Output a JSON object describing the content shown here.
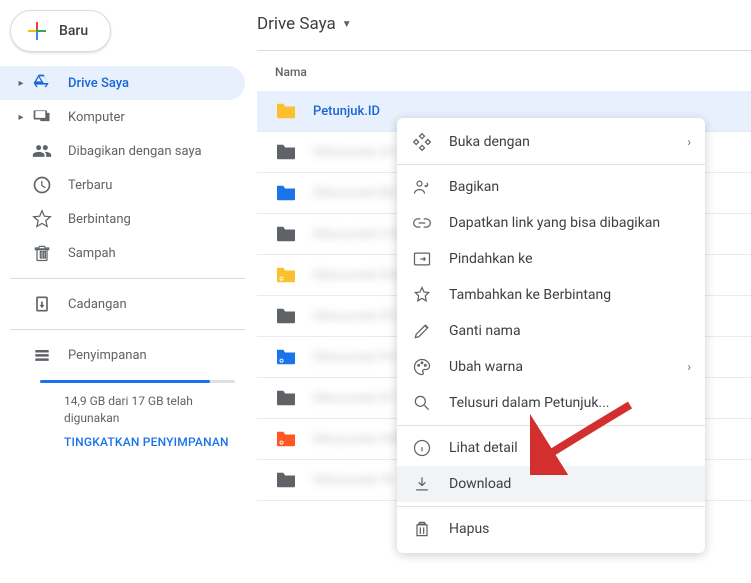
{
  "sidebar": {
    "new_label": "Baru",
    "items": [
      {
        "label": "Drive Saya",
        "icon": "drive",
        "expandable": true,
        "active": true
      },
      {
        "label": "Komputer",
        "icon": "computer",
        "expandable": true
      },
      {
        "label": "Dibagikan dengan saya",
        "icon": "shared"
      },
      {
        "label": "Terbaru",
        "icon": "recent"
      },
      {
        "label": "Berbintang",
        "icon": "star"
      },
      {
        "label": "Sampah",
        "icon": "trash"
      }
    ],
    "backup_label": "Cadangan",
    "storage": {
      "label": "Penyimpanan",
      "text": "14,9 GB dari 17 GB telah digunakan",
      "upgrade": "TINGKATKAN PENYIMPANAN",
      "percent": 87
    }
  },
  "breadcrumb": {
    "title": "Drive Saya"
  },
  "column_header": "Nama",
  "files": [
    {
      "name": "Petunjuk.ID",
      "color": "#fbc02d",
      "shared": false,
      "selected": true
    },
    {
      "name": "Obscured A1",
      "color": "#5f6368",
      "shared": false,
      "blur": true
    },
    {
      "name": "Obscured B2",
      "color": "#1a73e8",
      "shared": false,
      "blur": true
    },
    {
      "name": "Obscured C3",
      "color": "#5f6368",
      "shared": false,
      "blur": true
    },
    {
      "name": "Obscured D4",
      "color": "#fbc02d",
      "shared": true,
      "blur": true
    },
    {
      "name": "Obscured E5",
      "color": "#5f6368",
      "shared": false,
      "blur": true
    },
    {
      "name": "Obscured F6",
      "color": "#1a73e8",
      "shared": true,
      "blur": true
    },
    {
      "name": "Obscured G7",
      "color": "#5f6368",
      "shared": false,
      "blur": true
    },
    {
      "name": "Obscured H8",
      "color": "#ff5722",
      "shared": true,
      "blur": true
    },
    {
      "name": "Obscured I9",
      "color": "#5f6368",
      "shared": false,
      "blur": true
    }
  ],
  "context_menu": {
    "groups": [
      [
        {
          "label": "Buka dengan",
          "icon": "open",
          "submenu": true
        }
      ],
      [
        {
          "label": "Bagikan",
          "icon": "share"
        },
        {
          "label": "Dapatkan link yang bisa dibagikan",
          "icon": "link"
        },
        {
          "label": "Pindahkan ke",
          "icon": "move"
        },
        {
          "label": "Tambahkan ke Berbintang",
          "icon": "star"
        },
        {
          "label": "Ganti nama",
          "icon": "rename"
        },
        {
          "label": "Ubah warna",
          "icon": "palette",
          "submenu": true
        },
        {
          "label": "Telusuri dalam Petunjuk...",
          "icon": "search"
        }
      ],
      [
        {
          "label": "Lihat detail",
          "icon": "info"
        },
        {
          "label": "Download",
          "icon": "download",
          "highlight": true
        }
      ],
      [
        {
          "label": "Hapus",
          "icon": "trash"
        }
      ]
    ]
  },
  "colors": {
    "accent": "#1a73e8",
    "arrow": "#d32f2f"
  }
}
